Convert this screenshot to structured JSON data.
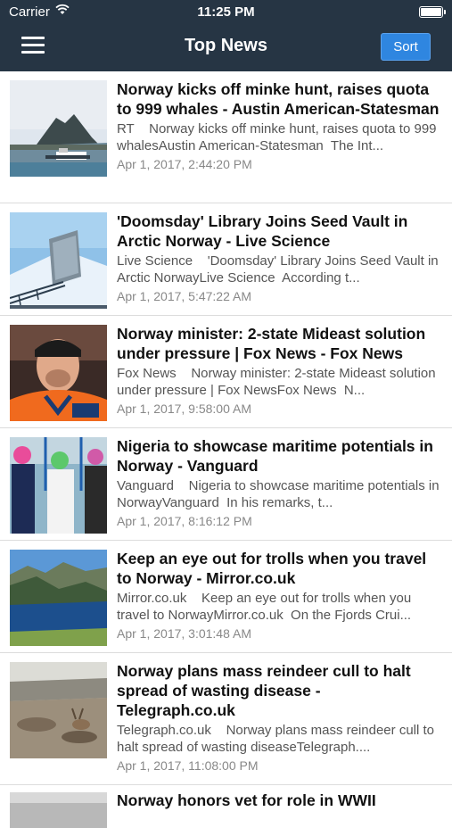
{
  "status_bar": {
    "carrier": "Carrier",
    "time": "11:25 PM"
  },
  "nav": {
    "title": "Top News",
    "sort_label": "Sort"
  },
  "articles": [
    {
      "headline": "Norway kicks off minke hunt, raises quota to 999 whales - Austin American-Statesman",
      "snippet": "RT    Norway kicks off minke hunt, raises quota to 999 whalesAustin American-Statesman  The Int...",
      "date": "Apr 1, 2017, 2:44:20 PM"
    },
    {
      "headline": "'Doomsday' Library Joins Seed Vault in Arctic Norway - Live Science",
      "snippet": "Live Science    'Doomsday' Library Joins Seed Vault in Arctic NorwayLive Science  According t...",
      "date": "Apr 1, 2017, 5:47:22 AM"
    },
    {
      "headline": "Norway minister: 2-state Mideast solution under pressure | Fox News - Fox News",
      "snippet": "Fox News    Norway minister: 2-state Mideast solution under pressure | Fox NewsFox News  N...",
      "date": "Apr 1, 2017, 9:58:00 AM"
    },
    {
      "headline": "Nigeria to showcase maritime potentials in Norway - Vanguard",
      "snippet": "Vanguard    Nigeria to showcase maritime potentials in NorwayVanguard  In his remarks, t...",
      "date": "Apr 1, 2017, 8:16:12 PM"
    },
    {
      "headline": "Keep an eye out for trolls when you travel to Norway - Mirror.co.uk",
      "snippet": "Mirror.co.uk    Keep an eye out for trolls when you travel to NorwayMirror.co.uk  On the Fjords Crui...",
      "date": "Apr 1, 2017, 3:01:48 AM"
    },
    {
      "headline": "Norway plans mass reindeer cull to halt spread of wasting disease - Telegraph.co.uk",
      "snippet": "Telegraph.co.uk    Norway plans mass reindeer cull to halt spread of wasting diseaseTelegraph....",
      "date": "Apr 1, 2017, 11:08:00 PM"
    }
  ],
  "partial_article": {
    "headline": "Norway honors vet for role in WWII"
  }
}
